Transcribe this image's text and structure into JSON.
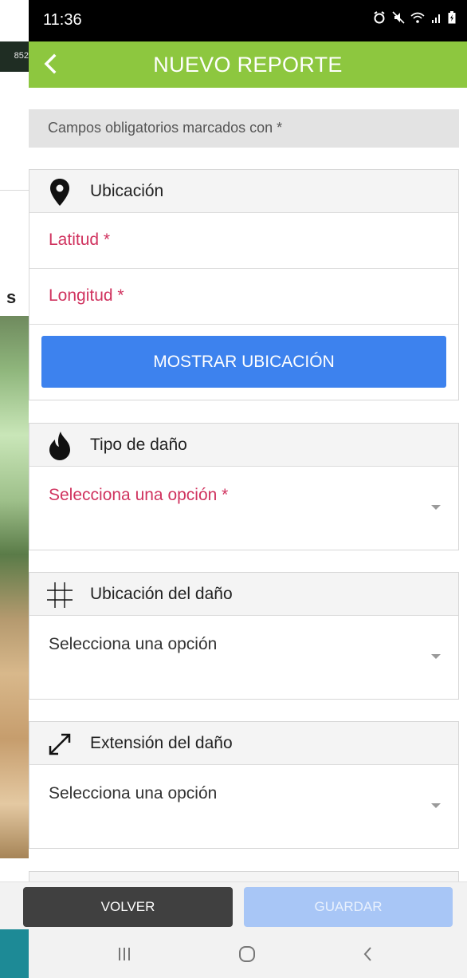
{
  "background_app": {
    "strip_text": "852",
    "heading_fragment": "s"
  },
  "status_bar": {
    "time": "11:36",
    "icons": [
      "alarm-icon",
      "mute-icon",
      "wifi-icon",
      "signal-icon",
      "battery-icon"
    ]
  },
  "header": {
    "title": "NUEVO REPORTE",
    "back_icon": "chevron-left-icon",
    "color": "#8dc73f"
  },
  "form": {
    "required_note": "Campos obligatorios marcados con *",
    "location_section": {
      "title": "Ubicación",
      "icon": "map-pin-icon",
      "latitude_label": "Latitud *",
      "longitude_label": "Longitud *",
      "show_button": "MOSTRAR UBICACIÓN"
    },
    "damage_type_section": {
      "title": "Tipo de daño",
      "icon": "flame-icon",
      "select_value": "Selecciona una opción *"
    },
    "damage_location_section": {
      "title": "Ubicación del daño",
      "icon": "grid-icon",
      "select_value": "Selecciona una opción"
    },
    "damage_extent_section": {
      "title": "Extensión del daño",
      "icon": "expand-arrow-icon",
      "select_value": "Selecciona una opción"
    }
  },
  "actions": {
    "back_label": "VOLVER",
    "save_label": "GUARDAR"
  },
  "colors": {
    "required_text": "#d0335f",
    "primary_button": "#3d82ee",
    "save_disabled": "#a8c6f6"
  }
}
